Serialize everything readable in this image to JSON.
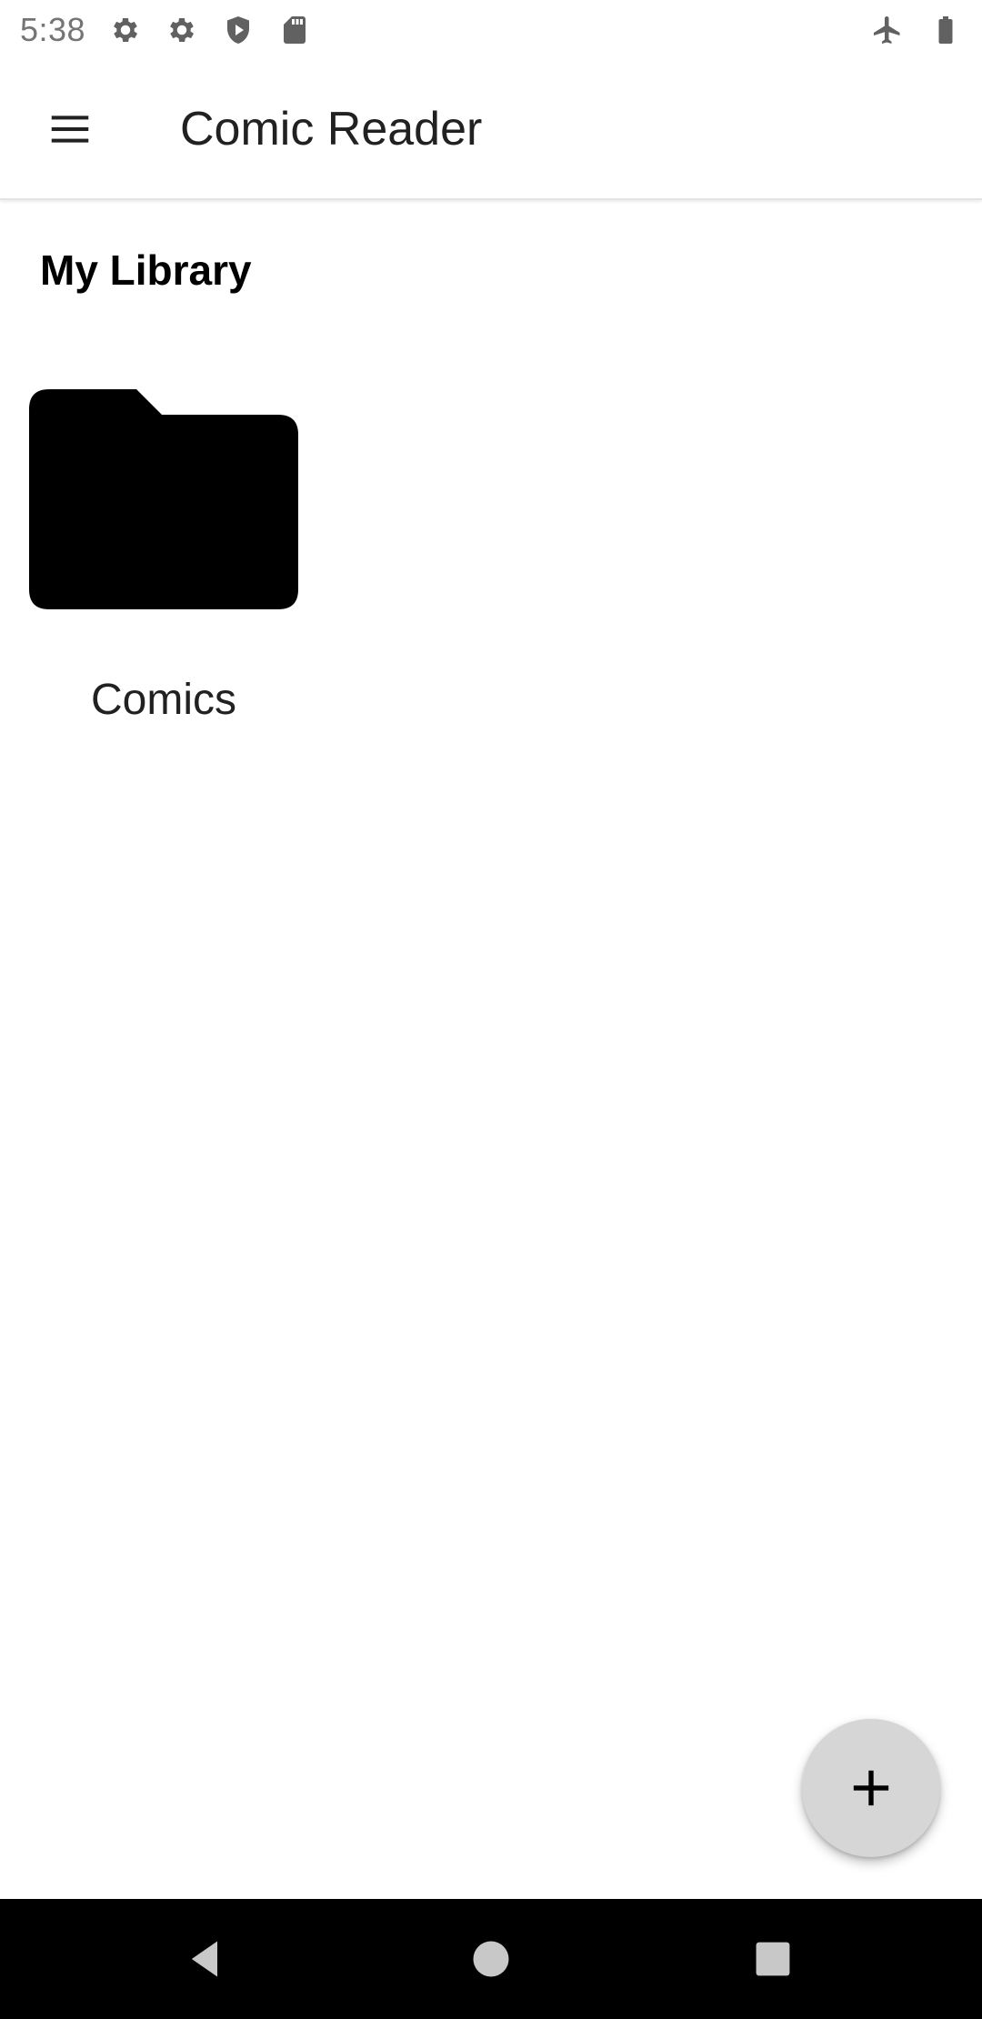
{
  "status_bar": {
    "time": "5:38",
    "left_icons": [
      "settings-icon",
      "settings-icon",
      "shield-play-icon",
      "sd-card-icon"
    ],
    "right_icons": [
      "airplane-mode-icon",
      "battery-icon"
    ]
  },
  "app_bar": {
    "menu_icon": "hamburger-menu-icon",
    "title": "Comic Reader"
  },
  "library": {
    "section_title": "My Library",
    "folders": [
      {
        "label": "Comics",
        "icon": "folder-icon"
      }
    ]
  },
  "fab": {
    "icon": "plus-icon"
  },
  "nav_bar": {
    "buttons": [
      "back-icon",
      "home-icon",
      "recents-icon"
    ]
  },
  "colors": {
    "background": "#ffffff",
    "fab": "#d6d6d6",
    "nav_bar": "#000000",
    "status_icon": "#616161"
  }
}
